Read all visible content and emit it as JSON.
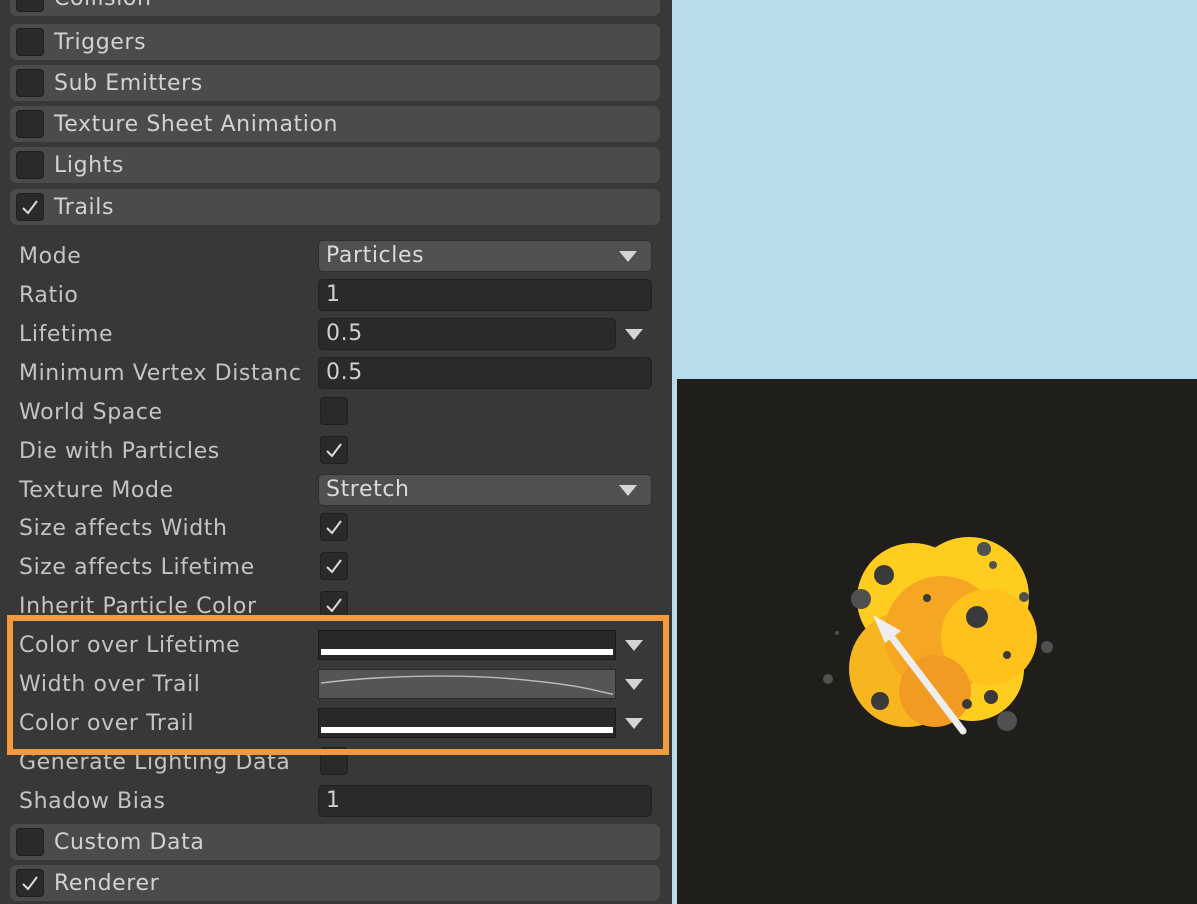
{
  "modules_top": [
    {
      "label": "Collision",
      "checked": false
    },
    {
      "label": "Triggers",
      "checked": false
    },
    {
      "label": "Sub Emitters",
      "checked": false
    },
    {
      "label": "Texture Sheet Animation",
      "checked": false
    },
    {
      "label": "Lights",
      "checked": false
    },
    {
      "label": "Trails",
      "checked": true
    }
  ],
  "trails": {
    "mode": {
      "label": "Mode",
      "value": "Particles"
    },
    "ratio": {
      "label": "Ratio",
      "value": "1"
    },
    "lifetime": {
      "label": "Lifetime",
      "value": "0.5"
    },
    "min_vertex_distance": {
      "label": "Minimum Vertex Distanc",
      "value": "0.5"
    },
    "world_space": {
      "label": "World Space",
      "checked": false
    },
    "die_with_particles": {
      "label": "Die with Particles",
      "checked": true
    },
    "texture_mode": {
      "label": "Texture Mode",
      "value": "Stretch"
    },
    "size_affects_width": {
      "label": "Size affects Width",
      "checked": true
    },
    "size_affects_lifetime": {
      "label": "Size affects Lifetime",
      "checked": true
    },
    "inherit_particle_color": {
      "label": "Inherit Particle Color",
      "checked": true
    },
    "color_over_lifetime": {
      "label": "Color over Lifetime"
    },
    "width_over_trail": {
      "label": "Width over Trail"
    },
    "color_over_trail": {
      "label": "Color over Trail"
    },
    "generate_lighting_data": {
      "label": "Generate Lighting Data",
      "checked": false
    },
    "shadow_bias": {
      "label": "Shadow Bias",
      "value": "1"
    }
  },
  "modules_bottom": [
    {
      "label": "Custom Data",
      "checked": false
    },
    {
      "label": "Renderer",
      "checked": true
    }
  ],
  "colors": {
    "panel_bg": "#383838",
    "module_bg": "#4b4b4b",
    "highlight": "#f39a3f",
    "page_bg": "#b8dde8",
    "preview_bg": "#201e1b",
    "particle_yellow": "#ffcd1f",
    "particle_orange": "#f5a623"
  },
  "icons": {
    "checkmark": "checkmark-icon",
    "dropdown": "caret-down-icon",
    "arrow": "arrow-icon"
  }
}
